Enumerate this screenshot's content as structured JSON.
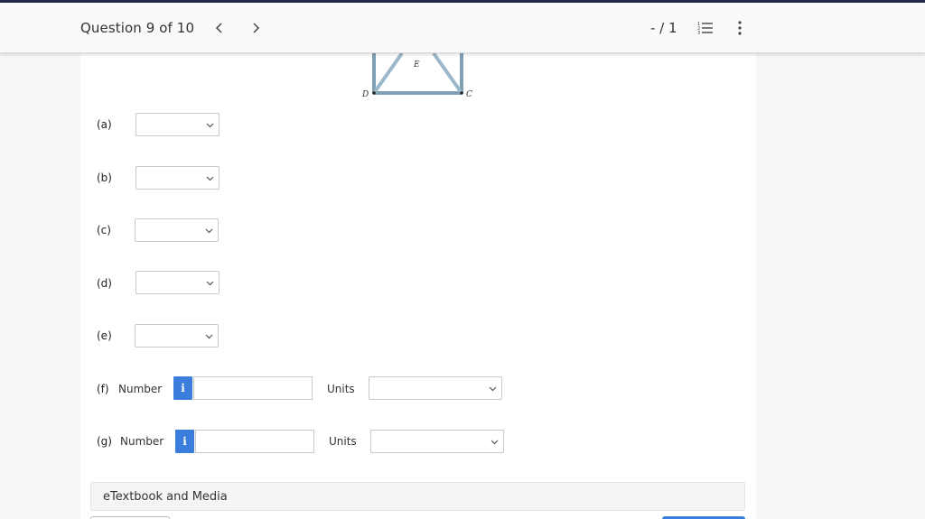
{
  "header": {
    "question_label": "Question 9 of 10",
    "score": "- / 1"
  },
  "figure": {
    "label_D": "D",
    "label_E": "E",
    "label_C": "C"
  },
  "parts": [
    {
      "label": "(a)"
    },
    {
      "label": "(b)"
    },
    {
      "label": "(c)"
    },
    {
      "label": "(d)"
    },
    {
      "label": "(e)"
    },
    {
      "label": "(f)",
      "number_label": "Number",
      "info": "i",
      "units_label": "Units",
      "number_value": ""
    },
    {
      "label": "(g)",
      "number_label": "Number",
      "info": "i",
      "units_label": "Units",
      "number_value": ""
    }
  ],
  "etextbook": {
    "label": "eTextbook and Media"
  },
  "colors": {
    "accent": "#3b7ddd",
    "truss": "#7ea0b5",
    "top_bar": "#1f2a44"
  },
  "icons": {
    "prev": "chevron-left-icon",
    "next": "chevron-right-icon",
    "list": "list-icon",
    "menu": "more-vertical-icon"
  }
}
